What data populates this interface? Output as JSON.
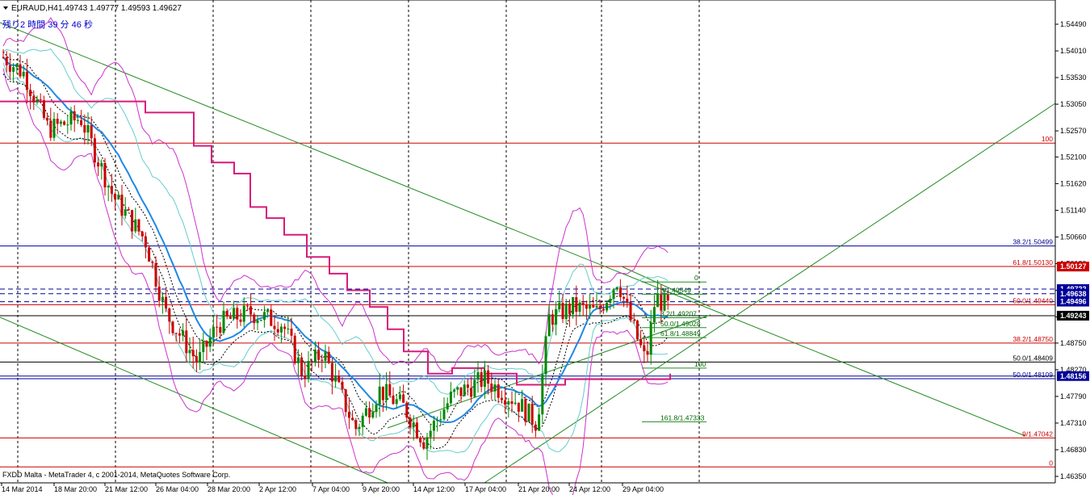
{
  "header": {
    "symbol": "EURAUD,H4",
    "ohlc": "1.49743 1.49777 1.49593 1.49627",
    "countdown": "残り2 時間 39 分 46 秒",
    "copyright": "FXDD Malta - MetaTrader 4, c 2001-2014, MetaQuotes Software Corp."
  },
  "colors": {
    "background": "#ffffff",
    "grid": "#000000",
    "bull": "#008800",
    "bear": "#cc0000",
    "ma_blue": "#1e88e5",
    "ma_pink": "#d81b7a",
    "bands_magenta": "#cc33cc",
    "bands_cyan": "#66cccc",
    "fib_red": "#cc0000",
    "fib_green": "#228b22",
    "fib_blue": "#000099"
  },
  "chart_data": {
    "type": "candlestick",
    "symbol": "EURAUD",
    "timeframe": "H4",
    "y_ticks": [
      1.5449,
      1.5401,
      1.5353,
      1.5305,
      1.5257,
      1.521,
      1.5162,
      1.5114,
      1.5066,
      1.5018,
      1.497,
      1.4922,
      1.4875,
      1.4827,
      1.4779,
      1.4731,
      1.4683,
      1.4635
    ],
    "y_tick_labels": [
      "1.54490",
      "1.54010",
      "1.53530",
      "1.53050",
      "1.52570",
      "1.52100",
      "1.51620",
      "1.51140",
      "1.50660",
      "1.50180",
      "1.49700",
      "1.49220",
      "1.48750",
      "1.48270",
      "1.47790",
      "1.47310",
      "1.46830",
      "1.46350"
    ],
    "ylim": [
      1.4635,
      1.5482
    ],
    "x_labels": [
      "14 Mar 2014",
      "18 Mar 20:00",
      "21 Mar 12:00",
      "26 Mar 04:00",
      "28 Mar 20:00",
      "2 Apr 12:00",
      "7 Apr 04:00",
      "9 Apr 20:00",
      "14 Apr 12:00",
      "17 Apr 04:00",
      "21 Apr 20:00",
      "24 Apr 12:00",
      "29 Apr 04:00"
    ],
    "price_tags": [
      {
        "value": "1.50127",
        "price": 1.50127,
        "color": "#cc0000"
      },
      {
        "value": "1.49722",
        "price": 1.49722,
        "color": "#000099"
      },
      {
        "value": "1.49638",
        "price": 1.49638,
        "color": "#000099"
      },
      {
        "value": "1.49496",
        "price": 1.49496,
        "color": "#000099"
      },
      {
        "value": "1.49243",
        "price": 1.49243,
        "color": "#000000"
      },
      {
        "value": "1.48156",
        "price": 1.48156,
        "color": "#000099"
      }
    ],
    "fib_levels": [
      {
        "label": "100",
        "price": 1.5235,
        "color": "#cc0000"
      },
      {
        "label": "38.2/1.50499",
        "price": 1.50499,
        "color": "#000099"
      },
      {
        "label": "61.8/1.50130",
        "price": 1.5013,
        "color": "#cc0000"
      },
      {
        "label": "50.0/1.49440",
        "price": 1.4944,
        "color": "#cc0000"
      },
      {
        "label": "38.2/1.48750",
        "price": 1.4875,
        "color": "#cc0000"
      },
      {
        "label": "50.0/1.48409",
        "price": 1.48409,
        "color": "#000000"
      },
      {
        "label": "50.0/1.48109",
        "price": 1.48109,
        "color": "#000099"
      },
      {
        "label": "9/1.47042",
        "price": 1.47042,
        "color": "#cc0000"
      },
      {
        "label": "0",
        "price": 1.4652,
        "color": "#cc0000"
      }
    ],
    "small_fib": [
      {
        "label": "0",
        "price": 1.4985
      },
      {
        "label": "3/1.49549",
        "price": 1.4963
      },
      {
        "label": "3.2/1.49207",
        "price": 1.49207
      },
      {
        "label": "50.0/1.49028",
        "price": 1.49028
      },
      {
        "label": "61.8/1.48849",
        "price": 1.48849
      },
      {
        "label": "100",
        "price": 1.483
      },
      {
        "label": "161.8/1.47333",
        "price": 1.47333
      }
    ],
    "grid": true
  }
}
